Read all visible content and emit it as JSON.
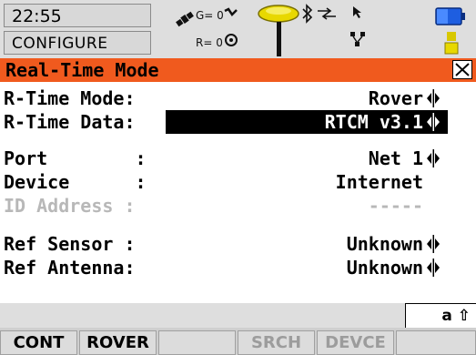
{
  "status": {
    "time": "22:55",
    "mode": "CONFIGURE",
    "sats_g": "G= 0",
    "sats_r": "R= 0"
  },
  "dialog": {
    "title": "Real-Time Mode"
  },
  "fields": {
    "rtime_mode": {
      "label": "R-Time Mode:",
      "value": "Rover"
    },
    "rtime_data": {
      "label": "R-Time Data:",
      "value": "RTCM v3.1"
    },
    "port": {
      "label": "Port        :",
      "value": "Net 1"
    },
    "device": {
      "label": "Device      :",
      "value": "Internet"
    },
    "id_address": {
      "label": "ID Address :",
      "value": "-----"
    },
    "ref_sensor": {
      "label": "Ref Sensor :",
      "value": "Unknown"
    },
    "ref_antenna": {
      "label": "Ref Antenna:",
      "value": "Unknown"
    }
  },
  "input_indicator": "a ⇧",
  "softkeys": {
    "f1": "CONT",
    "f2": "ROVER",
    "f3": "",
    "f4": "SRCH",
    "f5": "DEVCE",
    "f6": ""
  },
  "colors": {
    "title_bg": "#f05a1e",
    "highlight_bg": "#000000",
    "disabled_text": "#b8b8b8"
  }
}
